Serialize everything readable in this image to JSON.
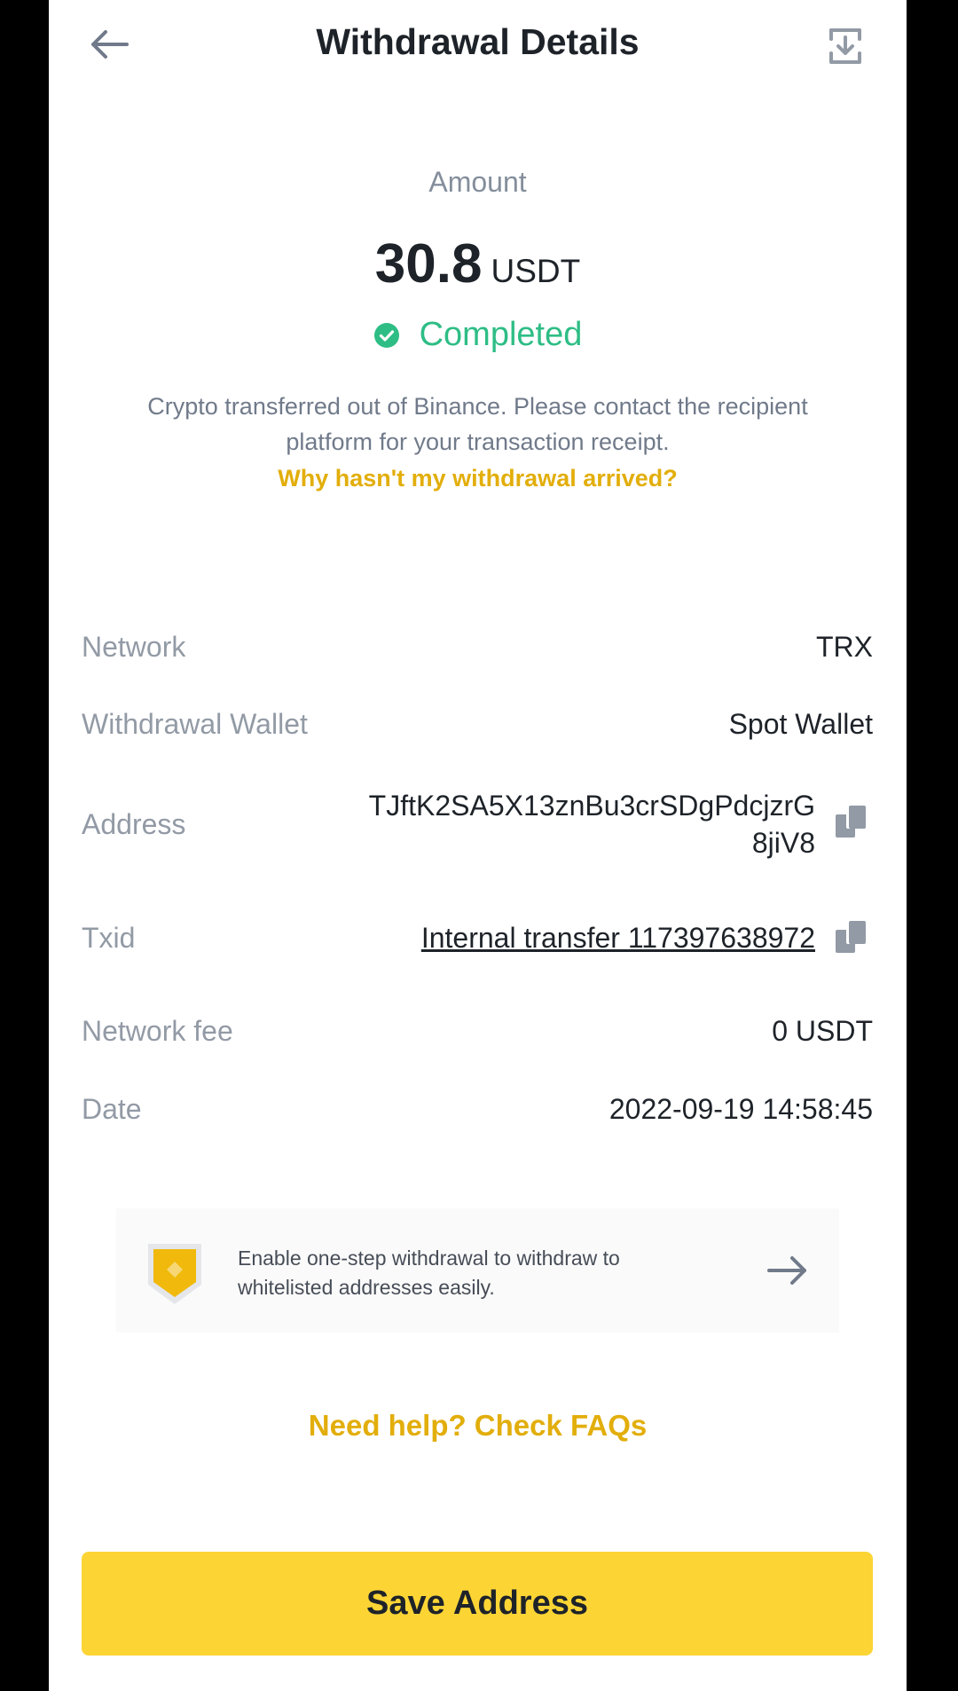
{
  "header": {
    "title": "Withdrawal Details",
    "back_icon": "arrow-left-icon",
    "download_icon": "download-icon"
  },
  "amount": {
    "label": "Amount",
    "value": "30.8",
    "unit": "USDT"
  },
  "status": {
    "text": "Completed",
    "icon": "check-circle-icon",
    "color": "#2ebd85"
  },
  "info": {
    "message": "Crypto transferred out of Binance. Please contact the recipient platform for your transaction receipt.",
    "link": "Why hasn't my withdrawal arrived?"
  },
  "details": {
    "network": {
      "label": "Network",
      "value": "TRX"
    },
    "wallet": {
      "label": "Withdrawal Wallet",
      "value": "Spot Wallet"
    },
    "address": {
      "label": "Address",
      "value": "TJftK2SA5X13znBu3crSDgPdcjzrG8jiV8"
    },
    "txid": {
      "label": "Txid",
      "value": "Internal transfer 117397638972"
    },
    "fee": {
      "label": "Network fee",
      "value": "0 USDT"
    },
    "date": {
      "label": "Date",
      "value": "2022-09-19 14:58:45"
    }
  },
  "banner": {
    "text": "Enable one-step withdrawal to withdraw to whitelisted addresses easily.",
    "icon": "shield-icon",
    "arrow_icon": "arrow-right-icon"
  },
  "help_link": "Need help? Check FAQs",
  "save_button": "Save Address",
  "colors": {
    "accent": "#fcd535",
    "link": "#e2ae0b",
    "success": "#2ebd85",
    "text_primary": "#1e2329",
    "text_secondary": "#929aa5"
  }
}
